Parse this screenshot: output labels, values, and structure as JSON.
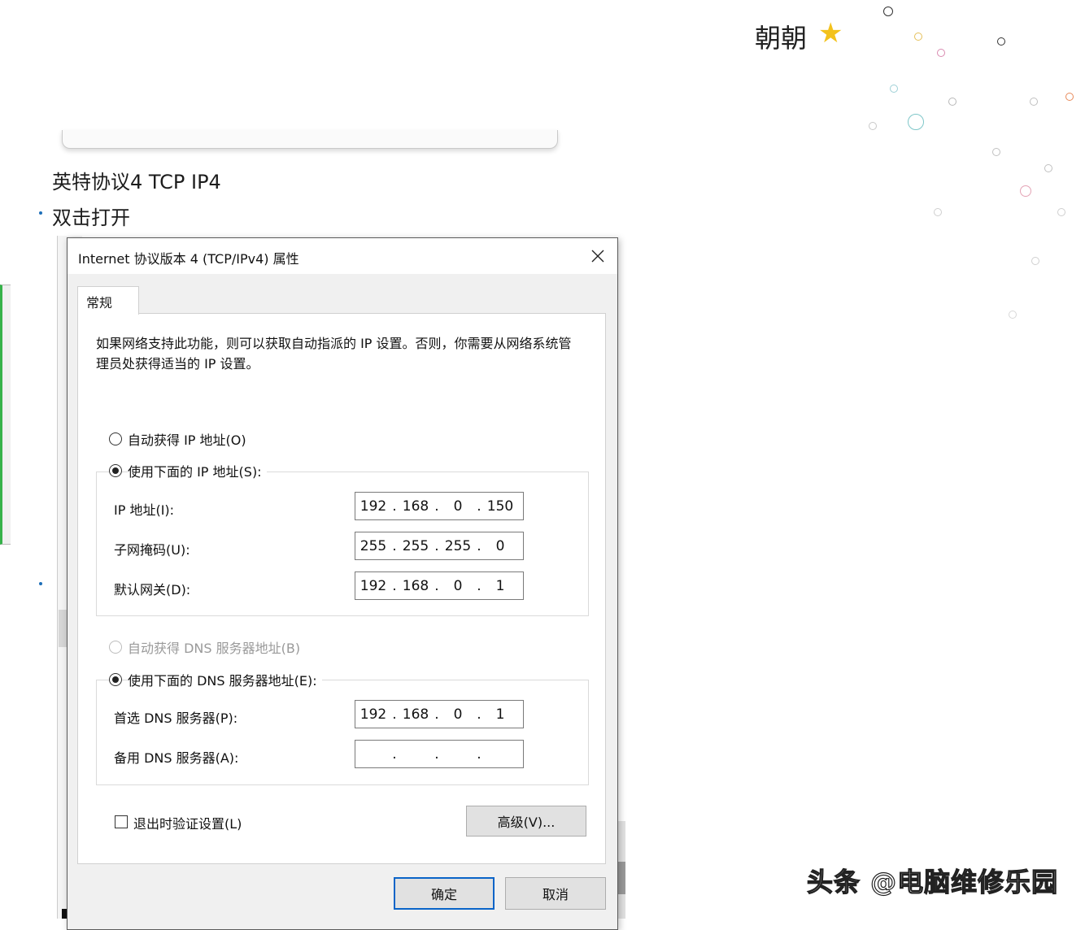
{
  "user": {
    "name": "朝朝"
  },
  "article": {
    "line1": "英特协议4  TCP IP4",
    "line2": "双击打开"
  },
  "dialog": {
    "title": "Internet 协议版本 4 (TCP/IPv4) 属性",
    "tab": "常规",
    "description": "如果网络支持此功能，则可以获取自动指派的 IP 设置。否则，你需要从网络系统管理员处获得适当的 IP 设置。",
    "radio_auto_ip": "自动获得 IP 地址(O)",
    "radio_manual_ip": "使用下面的 IP 地址(S):",
    "ip_fields": [
      {
        "label": "IP 地址(I):",
        "octets": [
          "192",
          "168",
          "0",
          "150"
        ]
      },
      {
        "label": "子网掩码(U):",
        "octets": [
          "255",
          "255",
          "255",
          "0"
        ]
      },
      {
        "label": "默认网关(D):",
        "octets": [
          "192",
          "168",
          "0",
          "1"
        ]
      }
    ],
    "radio_auto_dns": "自动获得 DNS 服务器地址(B)",
    "radio_manual_dns": "使用下面的 DNS 服务器地址(E):",
    "dns_fields": [
      {
        "label": "首选 DNS 服务器(P):",
        "octets": [
          "192",
          "168",
          "0",
          "1"
        ]
      },
      {
        "label": "备用 DNS 服务器(A):",
        "octets": [
          "",
          "",
          "",
          ""
        ]
      }
    ],
    "validate_checkbox": "退出时验证设置(L)",
    "advanced_button": "高级(V)...",
    "ok_button": "确定",
    "cancel_button": "取消"
  },
  "watermark": "头条 @电脑维修乐园",
  "colors": {
    "accent": "#0a64c8",
    "star": "#f3c21c",
    "green": "#36b24a"
  }
}
